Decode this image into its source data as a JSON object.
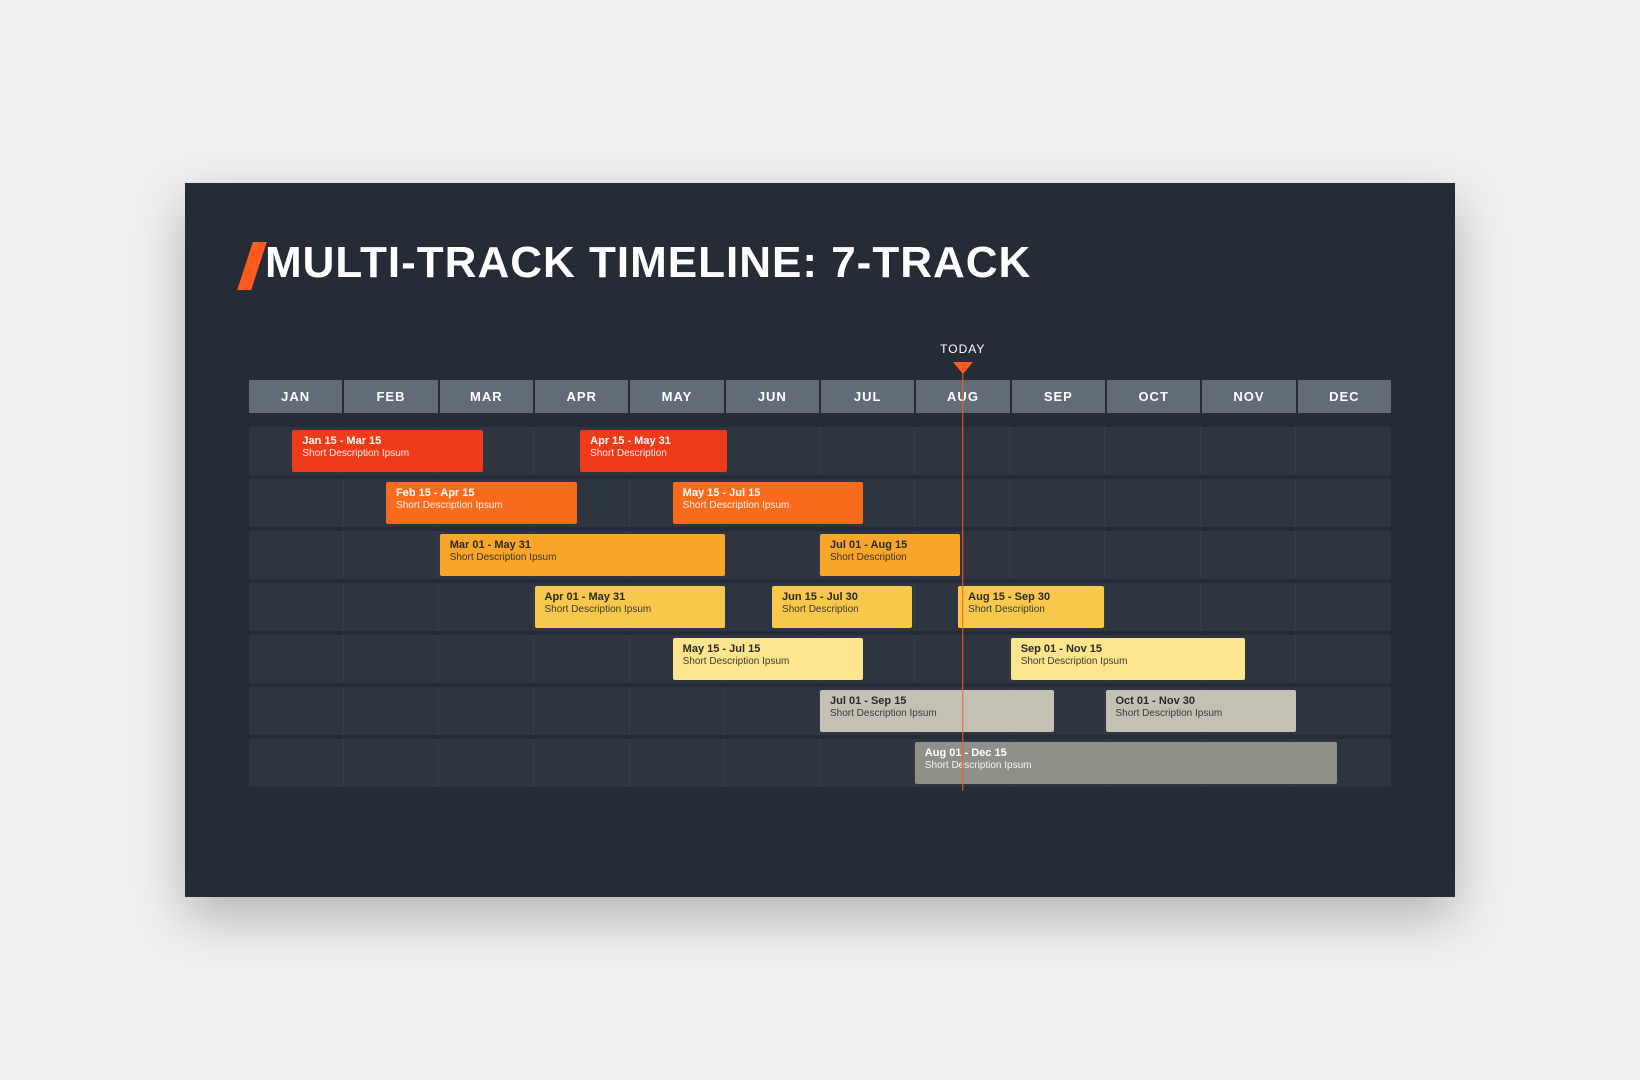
{
  "title": "MULTI-TRACK TIMELINE: 7-TRACK",
  "today_label": "TODAY",
  "today_position_pct": 62.5,
  "accent_color": "#ff5a1f",
  "months": [
    "JAN",
    "FEB",
    "MAR",
    "APR",
    "MAY",
    "JUN",
    "JUL",
    "AUG",
    "SEP",
    "OCT",
    "NOV",
    "DEC"
  ],
  "tracks": [
    {
      "bars": [
        {
          "date": "Jan 15 - Mar 15",
          "desc": "Short Description Ipsum",
          "start_pct": 3.8,
          "width_pct": 16.7,
          "bg": "#ed3a18",
          "text": "light"
        },
        {
          "date": "Apr 15 - May 31",
          "desc": "Short Description",
          "start_pct": 29.0,
          "width_pct": 12.9,
          "bg": "#ed3a18",
          "text": "light"
        }
      ]
    },
    {
      "bars": [
        {
          "date": "Feb 15 - Apr 15",
          "desc": "Short Description Ipsum",
          "start_pct": 12.0,
          "width_pct": 16.7,
          "bg": "#f86a1c",
          "text": "light"
        },
        {
          "date": "May 15 - Jul 15",
          "desc": "Short Description Ipsum",
          "start_pct": 37.1,
          "width_pct": 16.7,
          "bg": "#f86a1c",
          "text": "light"
        }
      ]
    },
    {
      "bars": [
        {
          "date": "Mar 01 - May 31",
          "desc": "Short Description Ipsum",
          "start_pct": 16.7,
          "width_pct": 25.0,
          "bg": "#f8a52a",
          "text": "dark"
        },
        {
          "date": "Jul 01 - Aug 15",
          "desc": "Short Description",
          "start_pct": 50.0,
          "width_pct": 12.3,
          "bg": "#f8a52a",
          "text": "dark"
        }
      ]
    },
    {
      "bars": [
        {
          "date": "Apr 01 - May 31",
          "desc": "Short Description Ipsum",
          "start_pct": 25.0,
          "width_pct": 16.7,
          "bg": "#f7c84c",
          "text": "dark"
        },
        {
          "date": "Jun 15 - Jul 30",
          "desc": "Short Description",
          "start_pct": 45.8,
          "width_pct": 12.3,
          "bg": "#f7c84c",
          "text": "dark"
        },
        {
          "date": "Aug 15 - Sep 30",
          "desc": "Short Description",
          "start_pct": 62.1,
          "width_pct": 12.8,
          "bg": "#f7c84c",
          "text": "dark"
        }
      ]
    },
    {
      "bars": [
        {
          "date": "May 15 - Jul 15",
          "desc": "Short Description Ipsum",
          "start_pct": 37.1,
          "width_pct": 16.7,
          "bg": "#fce58c",
          "text": "dark"
        },
        {
          "date": "Sep 01 - Nov 15",
          "desc": "Short Description Ipsum",
          "start_pct": 66.7,
          "width_pct": 20.5,
          "bg": "#fce58c",
          "text": "dark"
        }
      ]
    },
    {
      "bars": [
        {
          "date": "Jul 01 - Sep 15",
          "desc": "Short Description Ipsum",
          "start_pct": 50.0,
          "width_pct": 20.5,
          "bg": "#c4c0b4",
          "text": "dark"
        },
        {
          "date": "Oct 01 - Nov 30",
          "desc": "Short Description Ipsum",
          "start_pct": 75.0,
          "width_pct": 16.7,
          "bg": "#c4c0b4",
          "text": "dark"
        }
      ]
    },
    {
      "bars": [
        {
          "date": "Aug 01 - Dec 15",
          "desc": "Short Description Ipsum",
          "start_pct": 58.3,
          "width_pct": 37.0,
          "bg": "#8f8f88",
          "text": "light"
        }
      ]
    }
  ]
}
